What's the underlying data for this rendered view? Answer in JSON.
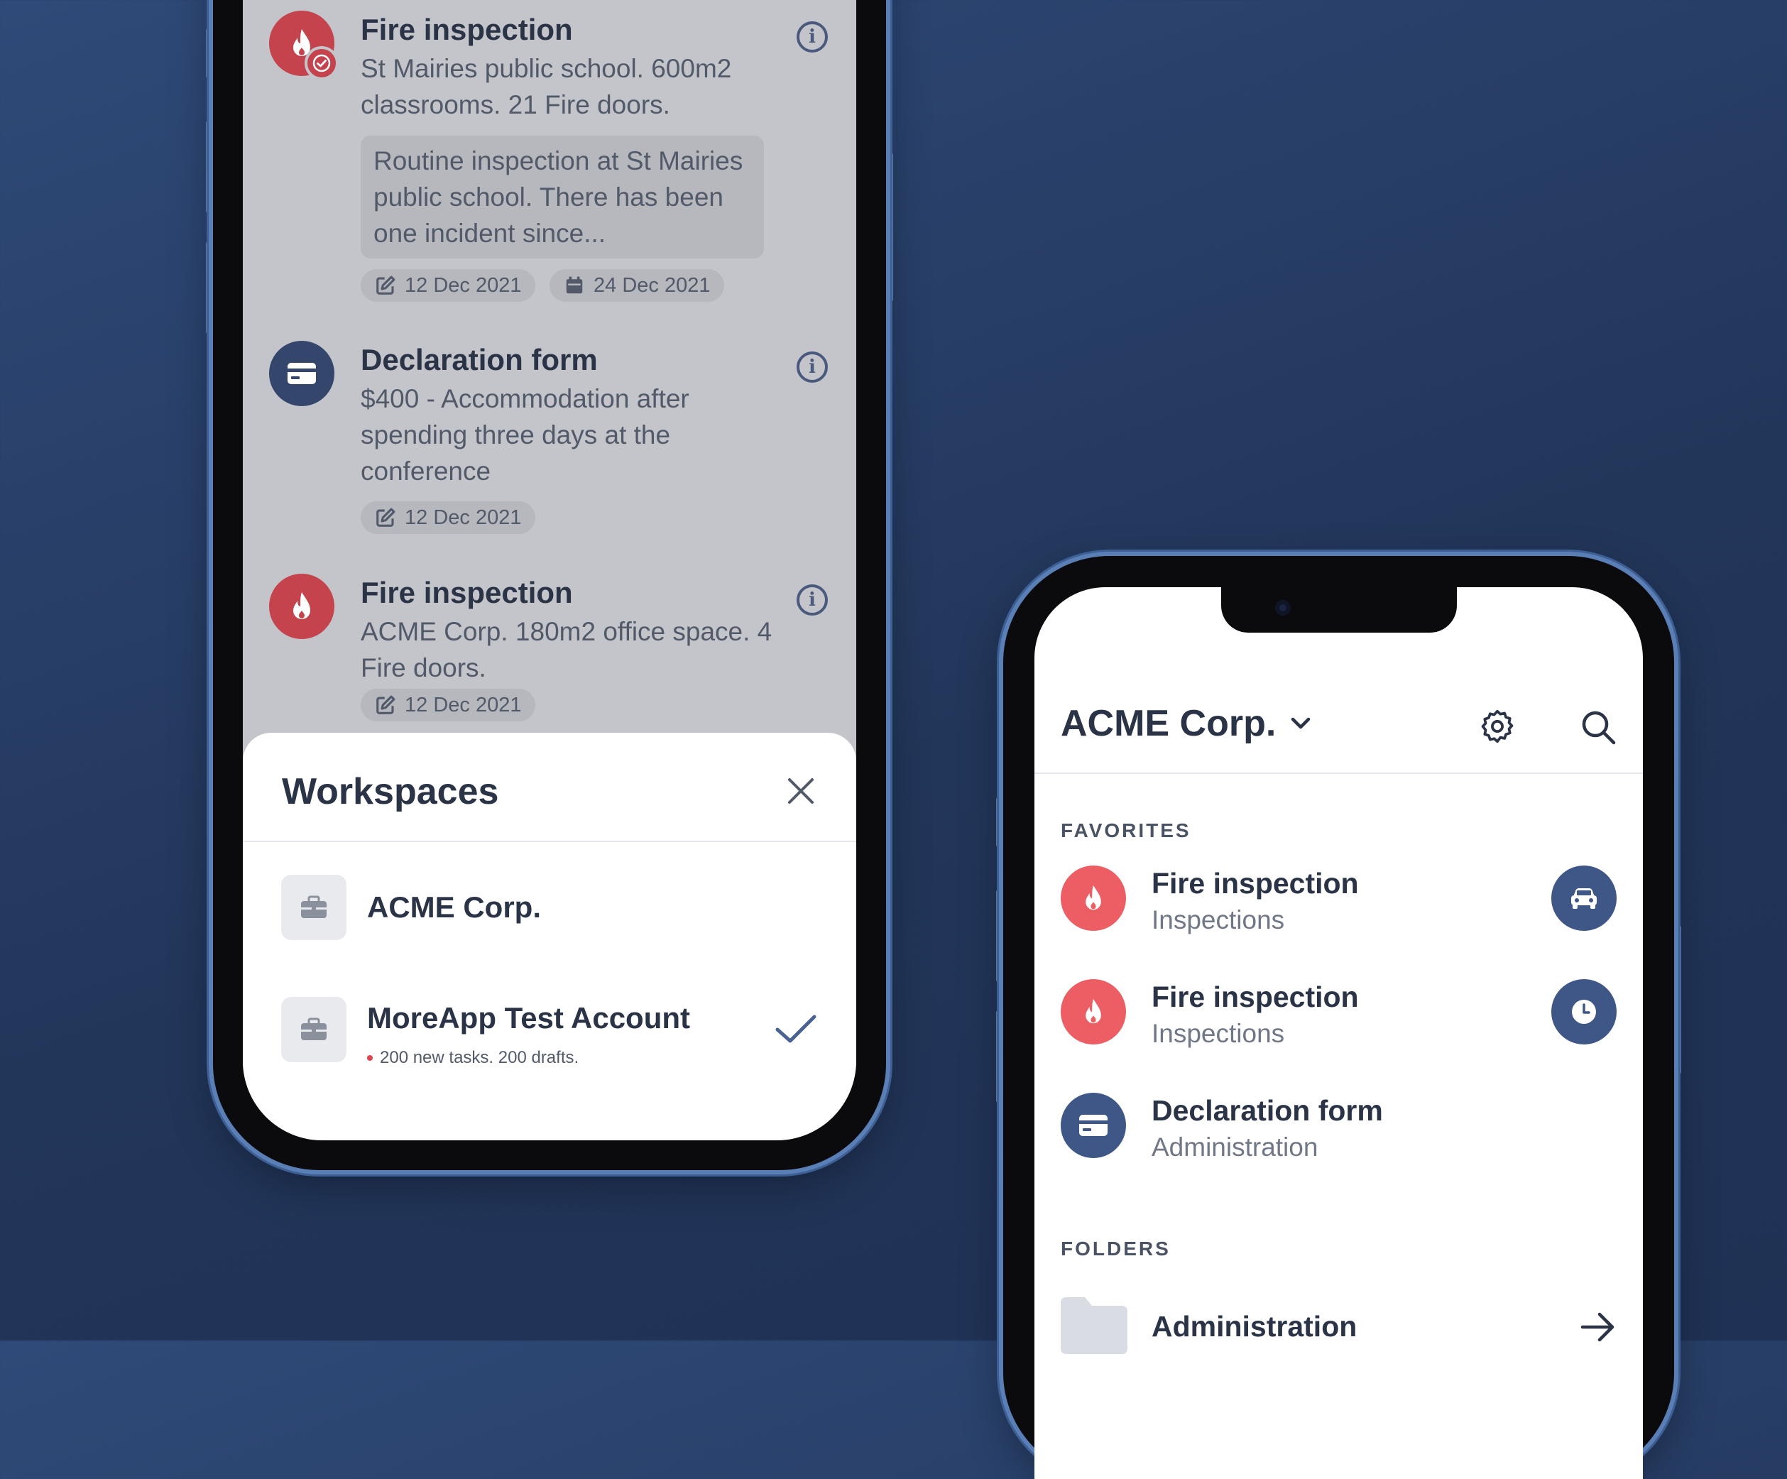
{
  "left_phone": {
    "tasks": [
      {
        "title": "Fire inspection",
        "description": "St Mairies public school. 600m2 classrooms. 21 Fire doors.",
        "note": "Routine inspection at St Mairies public school. There has been one incident since...",
        "edited_date": "12 Dec 2021",
        "due_date": "24 Dec 2021",
        "icon": "fire-check-icon",
        "color": "#c5434d"
      },
      {
        "title": "Declaration form",
        "description": "$400 - Accommodation after spending three days at the conference",
        "edited_date": "12 Dec 2021",
        "icon": "card-icon",
        "color": "#34466b"
      },
      {
        "title": "Fire inspection",
        "description": "ACME Corp. 180m2 office space. 4 Fire doors.",
        "edited_date": "12 Dec 2021",
        "icon": "fire-icon",
        "color": "#c5434d"
      }
    ],
    "info_glyph": "i",
    "sheet": {
      "title": "Workspaces",
      "workspaces": [
        {
          "name": "ACME Corp.",
          "subtitle": "",
          "selected": false
        },
        {
          "name": "MoreApp Test Account",
          "subtitle": "200 new tasks. 200 drafts.",
          "selected": true
        }
      ]
    }
  },
  "right_phone": {
    "header": {
      "title": "ACME Corp."
    },
    "favorites_label": "FAVORITES",
    "favorites": [
      {
        "name": "Fire inspection",
        "category": "Inspections",
        "tag_icon": "car-icon"
      },
      {
        "name": "Fire inspection",
        "category": "Inspections",
        "tag_icon": "clock-icon"
      },
      {
        "name": "Declaration form",
        "category": "Administration",
        "tag_icon": ""
      }
    ],
    "folders_label": "FOLDERS",
    "folders": [
      {
        "name": "Administration"
      }
    ]
  },
  "colors": {
    "background": "#26395f",
    "accent_red": "#ec5e63",
    "accent_blue": "#3e5786",
    "text_dark": "#2b3446"
  }
}
